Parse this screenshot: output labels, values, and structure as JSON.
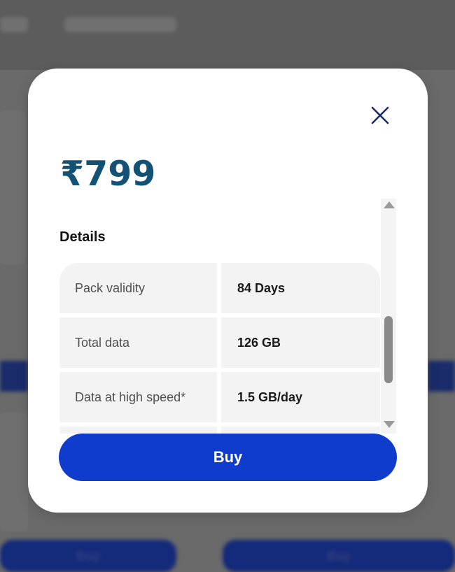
{
  "modal": {
    "price": "₹799",
    "section_title": "Details",
    "details": [
      {
        "label": "Pack validity",
        "value": "84 Days"
      },
      {
        "label": "Total data",
        "value": "126 GB"
      },
      {
        "label": "Data at high speed*",
        "value": "1.5 GB/day"
      },
      {
        "label": "",
        "value": ""
      }
    ],
    "buy_label": "Buy"
  },
  "background": {
    "buy_labels": [
      "Buy",
      "Buy"
    ]
  },
  "icons": {
    "close": "close-icon",
    "scroll_up": "scroll-up-arrow-icon",
    "scroll_down": "scroll-down-arrow-icon"
  },
  "colors": {
    "price": "#135274",
    "buy_button": "#0f3ccc",
    "close_icon": "#1a2b6a",
    "overlay": "#5e5e5e"
  }
}
